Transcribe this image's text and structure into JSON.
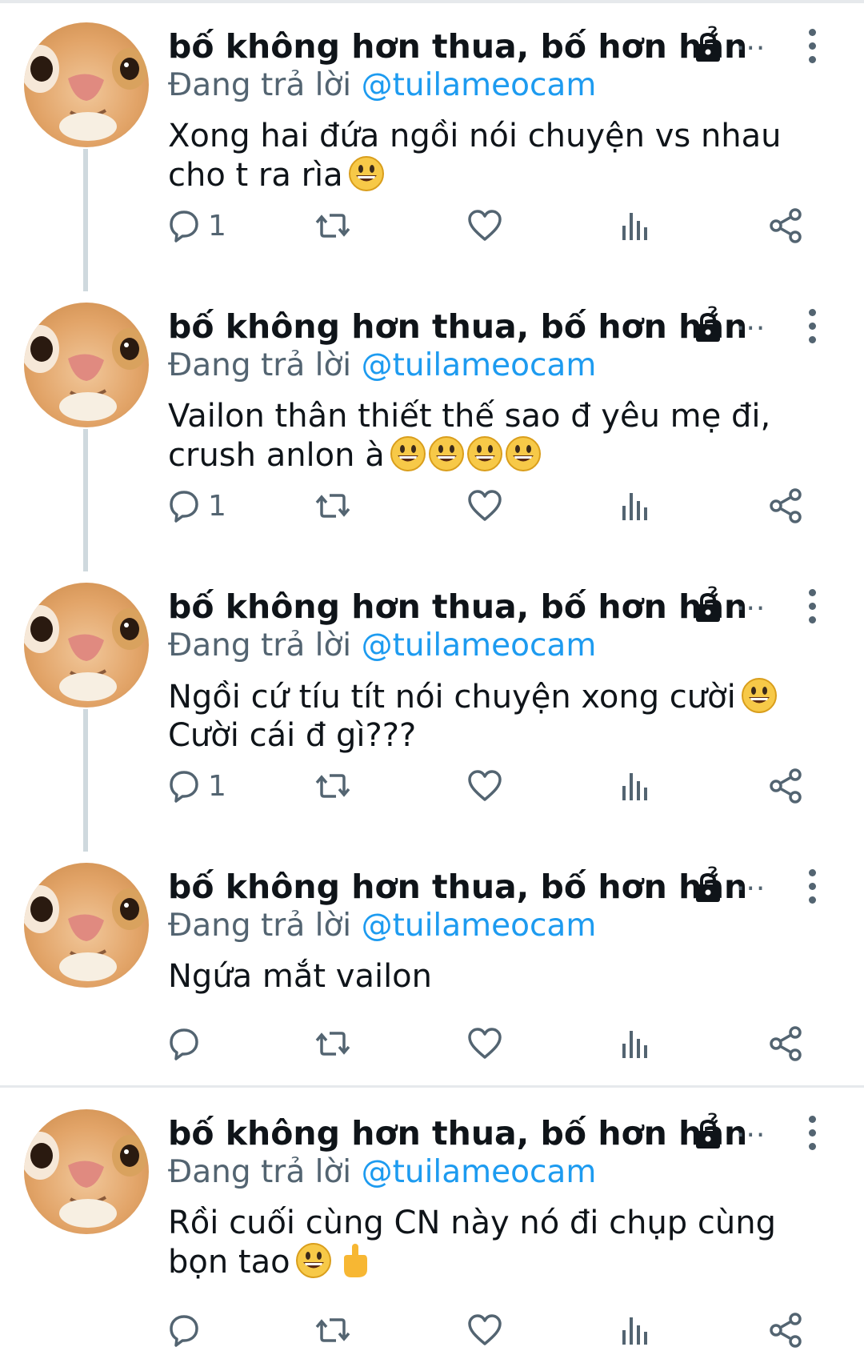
{
  "colors": {
    "accent": "#1d9bf0",
    "muted": "#536471",
    "text": "#0f1419",
    "thread": "#cfd9de"
  },
  "tweets": [
    {
      "name": "bố không hơn thua, bố hơn hẳn",
      "reply_prefix": "Đang trả lời",
      "handle": "@tuilameocam",
      "text": "Xong hai đứa ngồi nói chuyện vs nhau cho t ra rìa",
      "reply_count": "1"
    },
    {
      "name": "bố không hơn thua, bố hơn hẳn",
      "reply_prefix": "Đang trả lời",
      "handle": "@tuilameocam",
      "text": "Vailon thân thiết thế sao đ yêu mẹ đi, crush anlon à",
      "reply_count": "1"
    },
    {
      "name": "bố không hơn thua, bố hơn hẳn",
      "reply_prefix": "Đang trả lời",
      "handle": "@tuilameocam",
      "text": "Ngồi cứ tíu tít nói chuyện xong cười",
      "text2": "Cười cái đ gì???",
      "reply_count": "1"
    },
    {
      "name": "bố không hơn thua, bố hơn hẳn",
      "reply_prefix": "Đang trả lời",
      "handle": "@tuilameocam",
      "text": "Ngứa mắt vailon",
      "reply_count": ""
    },
    {
      "name": "bố không hơn thua, bố hơn hẳn",
      "reply_prefix": "Đang trả lời",
      "handle": "@tuilameocam",
      "text": "Rồi cuối cùng CN này nó đi chụp cùng bọn tao",
      "reply_count": ""
    }
  ],
  "icons": [
    "cat-avatar",
    "lock-icon",
    "more-dots-icon",
    "kebab-menu-icon",
    "reply-icon",
    "retweet-icon",
    "like-icon",
    "views-icon",
    "share-icon",
    "grinning-emoji",
    "middle-finger-emoji"
  ]
}
